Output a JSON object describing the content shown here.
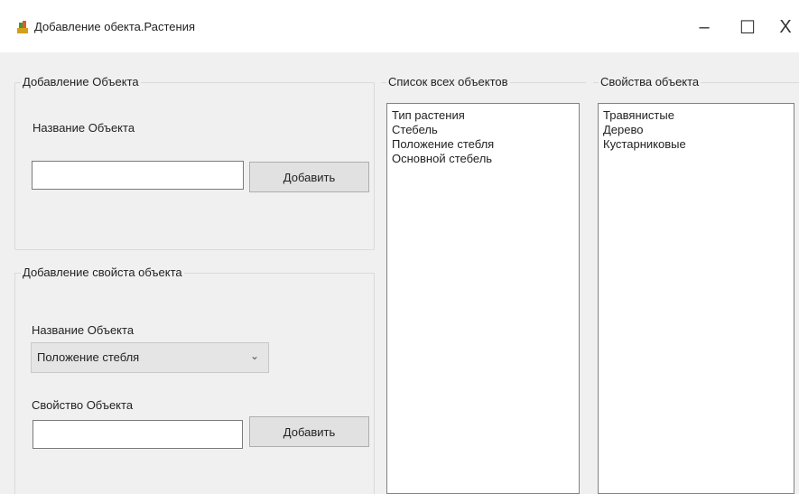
{
  "window": {
    "title": "Добавление обекта.Растения",
    "minimize": "–",
    "maximize": "☐",
    "close": "X"
  },
  "add_object_group": {
    "title": "Добавление Объекта",
    "name_label": "Название Объекта",
    "name_value": "",
    "add_button": "Добавить"
  },
  "add_property_group": {
    "title": "Добавление свойста объекта",
    "object_label": "Название Объекта",
    "object_selected": "Положение стебля",
    "property_label": "Свойство Объекта",
    "property_value": "",
    "add_button": "Добавить"
  },
  "objects_list": {
    "title": "Список всех объектов",
    "items": [
      "Тип растения",
      "Стебель",
      "Положение стебля",
      "Основной стебель"
    ]
  },
  "properties_list": {
    "title": "Свойства объекта",
    "items": [
      "Травянистые",
      "Дерево",
      "Кустарниковые"
    ]
  },
  "colors": {
    "window_bg": "#f0f0f0",
    "titlebar_bg": "#ffffff",
    "button_bg": "#e1e1e1"
  },
  "icons": {
    "app_icon": "plant-app-icon",
    "combo_arrow": "chevron-down-icon"
  }
}
